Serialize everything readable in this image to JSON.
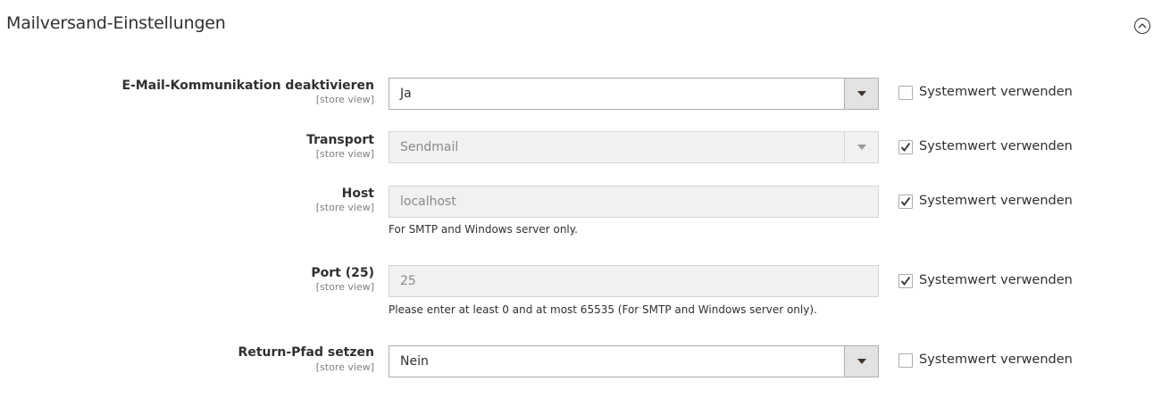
{
  "section": {
    "title": "Mailversand-Einstellungen",
    "collapse_icon": "chevron-up-circle-icon"
  },
  "rows": [
    {
      "label": "E-Mail-Kommunikation deaktivieren",
      "scope": "[store view]",
      "type": "select",
      "value": "Ja",
      "disabled": false,
      "use_system_value": false,
      "system_label": "Systemwert verwenden"
    },
    {
      "label": "Transport",
      "scope": "[store view]",
      "type": "select",
      "value": "Sendmail",
      "disabled": true,
      "use_system_value": true,
      "system_label": "Systemwert verwenden"
    },
    {
      "label": "Host",
      "scope": "[store view]",
      "type": "text",
      "value": "localhost",
      "disabled": true,
      "note": "For SMTP and Windows server only.",
      "use_system_value": true,
      "system_label": "Systemwert verwenden"
    },
    {
      "label": "Port (25)",
      "scope": "[store view]",
      "type": "text",
      "value": "25",
      "disabled": true,
      "note": "Please enter at least 0 and at most 65535 (For SMTP and Windows server only).",
      "use_system_value": true,
      "system_label": "Systemwert verwenden"
    },
    {
      "label": "Return-Pfad setzen",
      "scope": "[store view]",
      "type": "select",
      "value": "Nein",
      "disabled": false,
      "use_system_value": false,
      "system_label": "Systemwert verwenden"
    }
  ]
}
